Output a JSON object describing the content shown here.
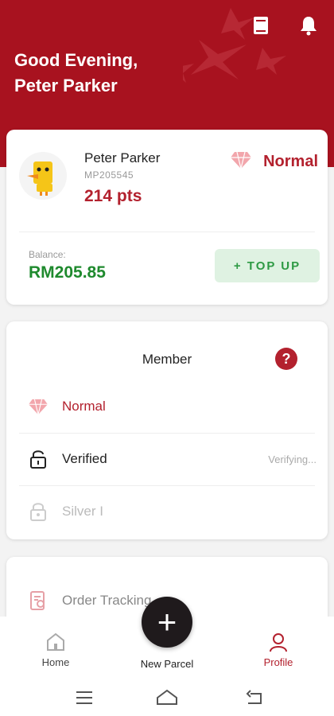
{
  "header": {
    "greeting": "Good Evening,",
    "user_name": "Peter Parker",
    "icons": [
      "book-icon",
      "bell-icon"
    ],
    "bg_color": "#a8121f"
  },
  "profile": {
    "name": "Peter Parker",
    "member_id": "MP205545",
    "points": "214 pts",
    "tier": "Normal",
    "balance_label": "Balance:",
    "balance_value": "RM205.85",
    "topup_label": "+ TOP UP"
  },
  "member": {
    "title": "Member",
    "help_glyph": "?",
    "rows": [
      {
        "label": "Normal",
        "icon": "diamond-icon",
        "status": ""
      },
      {
        "label": "Verified",
        "icon": "unlocked-icon",
        "status": "Verifying..."
      },
      {
        "label": "Silver I",
        "icon": "locked-icon",
        "status": ""
      }
    ]
  },
  "order": {
    "label": "Order Tracking"
  },
  "nav": {
    "items": [
      {
        "label": "Home",
        "icon": "home-icon"
      },
      {
        "label": "New Parcel",
        "icon": "plus-icon"
      },
      {
        "label": "Profile",
        "icon": "user-icon"
      }
    ],
    "fab_glyph": "+",
    "active_color": "#b3212e"
  },
  "system_nav": [
    "menu-icon",
    "home-outline-icon",
    "back-icon"
  ]
}
